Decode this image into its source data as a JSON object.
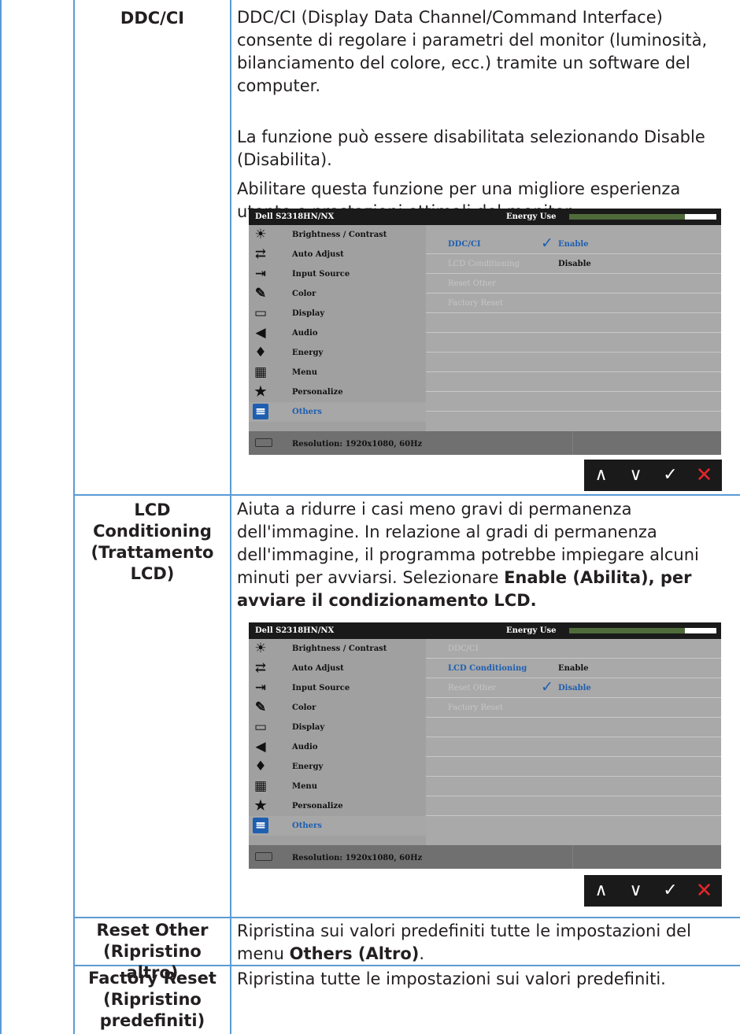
{
  "rows": [
    {
      "name": "DDC/CI",
      "paragraphs": [
        "DDC/CI (Display Data Channel/Command Interface) consente di regolare i parametri del monitor (luminosità, bilanciamento del colore, ecc.) tramite un software del computer.",
        "La funzione può essere disabilitata selezionando Disable (Disabilita).",
        "Abilitare questa funzione per una migliore esperienza utente e prestazioni ottimali del monitor."
      ],
      "osd": {
        "model": "Dell S2318HN/NX",
        "energy_label": "Energy Use",
        "menu": [
          {
            "label": "Brightness / Contrast",
            "icon": "brightness-icon"
          },
          {
            "label": "Auto Adjust",
            "icon": "auto-adjust-icon"
          },
          {
            "label": "Input Source",
            "icon": "input-source-icon"
          },
          {
            "label": "Color",
            "icon": "color-icon"
          },
          {
            "label": "Display",
            "icon": "display-icon"
          },
          {
            "label": "Audio",
            "icon": "audio-icon"
          },
          {
            "label": "Energy",
            "icon": "energy-icon"
          },
          {
            "label": "Menu",
            "icon": "menu-icon"
          },
          {
            "label": "Personalize",
            "icon": "personalize-icon"
          },
          {
            "label": "Others",
            "icon": "others-icon"
          }
        ],
        "submenu": [
          {
            "label": "DDC/CI",
            "value": "Enable",
            "checked": true,
            "active": true
          },
          {
            "label": "LCD Conditioning",
            "value": "Disable",
            "checked": false,
            "active": false
          },
          {
            "label": "Reset Other",
            "value": "",
            "active": false
          },
          {
            "label": "Factory Reset",
            "value": "",
            "active": false
          }
        ],
        "footer": "Resolution: 1920x1080, 60Hz"
      }
    },
    {
      "name_lines": [
        "LCD",
        "Conditioning",
        "(Trattamento",
        "LCD)"
      ],
      "paragraph_plain": "Aiuta a ridurre i casi meno gravi di permanenza dell'immagine. In relazione al gradi di permanenza dell'immagine, il programma potrebbe impiegare alcuni minuti per avviarsi. Selezionare ",
      "paragraph_bold": "Enable (Abilita), per avviare il condizionamento LCD.",
      "osd": {
        "model": "Dell S2318HN/NX",
        "energy_label": "Energy Use",
        "submenu": [
          {
            "label": "DDC/CI",
            "value": "",
            "active": false
          },
          {
            "label": "LCD Conditioning",
            "value": "Enable",
            "active": true
          },
          {
            "label": "Reset Other",
            "value": "Disable",
            "checked": true,
            "active": false
          },
          {
            "label": "Factory Reset",
            "value": "",
            "active": false
          }
        ],
        "footer": "Resolution: 1920x1080, 60Hz"
      }
    },
    {
      "name_lines": [
        "Reset Other",
        "(Ripristino altro)"
      ],
      "text_plain": "Ripristina sui valori predefiniti tutte le impostazioni del menu ",
      "text_bold": "Others (Altro)",
      "text_end": "."
    },
    {
      "name_lines": [
        "Factory Reset",
        "(Ripristino",
        "predefiniti)"
      ],
      "text": "Ripristina tutte le impostazioni sui valori predefiniti."
    }
  ],
  "nav_buttons": {
    "up": "∧",
    "down": "∨",
    "ok": "✓",
    "exit": "✕"
  },
  "colors": {
    "table_border": "#5b9bd5",
    "osd_accent": "#1f5fb0",
    "energy_bar": "#4f6b3a",
    "exit": "#e4262b"
  }
}
